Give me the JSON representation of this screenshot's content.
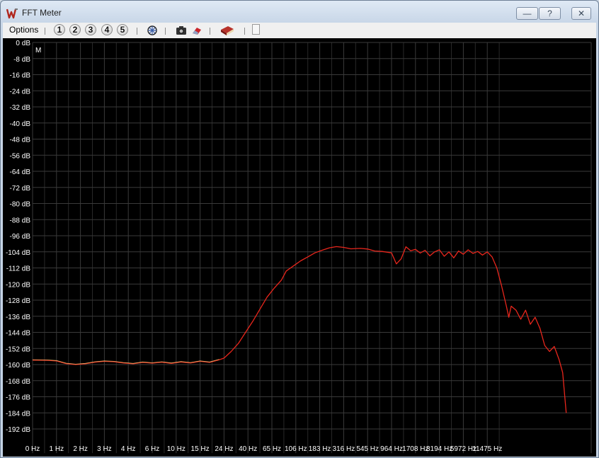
{
  "window": {
    "title": "FFT Meter",
    "minimize_label": "—",
    "help_label": "?",
    "close_label": "✕"
  },
  "toolbar": {
    "options_label": "Options",
    "presets": [
      "1",
      "2",
      "3",
      "4",
      "5"
    ],
    "icons": [
      "grid-icon",
      "camera-icon",
      "eraser-icon",
      "book-icon"
    ]
  },
  "colors": {
    "background": "#000000",
    "grid": "#3a3a3a",
    "axis_text": "#ffffff",
    "trace": "#e8261c",
    "trace_highlight": "#ffd27a"
  },
  "plot": {
    "marker": "M"
  },
  "chart_data": {
    "type": "line",
    "title": "",
    "xlabel": "",
    "ylabel": "",
    "x_scale": "log-like, labeled bins",
    "ylim": [
      -198,
      0
    ],
    "y_ticks": [
      "0 dB",
      "-8 dB",
      "-16 dB",
      "-24 dB",
      "-32 dB",
      "-40 dB",
      "-48 dB",
      "-56 dB",
      "-64 dB",
      "-72 dB",
      "-80 dB",
      "-88 dB",
      "-96 dB",
      "-104 dB",
      "-112 dB",
      "-120 dB",
      "-128 dB",
      "-136 dB",
      "-144 dB",
      "-152 dB",
      "-160 dB",
      "-168 dB",
      "-176 dB",
      "-184 dB",
      "-192 dB"
    ],
    "x_ticks": [
      "0 Hz",
      "1 Hz",
      "2 Hz",
      "3 Hz",
      "4 Hz",
      "6 Hz",
      "10 Hz",
      "15 Hz",
      "24 Hz",
      "40 Hz",
      "65 Hz",
      "106 Hz",
      "183 Hz",
      "316 Hz",
      "545 Hz",
      "964 Hz",
      "1708 Hz",
      "3194 Hz",
      "5972 Hz",
      "11475 Hz"
    ],
    "grid": true,
    "series": [
      {
        "points": [
          [
            0,
            -157.8
          ],
          [
            0.6,
            -157.9
          ],
          [
            1.0,
            -158.2
          ],
          [
            1.4,
            -159.5
          ],
          [
            1.8,
            -160.0
          ],
          [
            2.2,
            -159.6
          ],
          [
            2.6,
            -158.8
          ],
          [
            3.0,
            -158.4
          ],
          [
            3.4,
            -158.6
          ],
          [
            3.8,
            -159.2
          ],
          [
            4.2,
            -159.6
          ],
          [
            4.6,
            -158.9
          ],
          [
            5.0,
            -159.3
          ],
          [
            5.4,
            -158.8
          ],
          [
            5.8,
            -159.4
          ],
          [
            6.2,
            -158.7
          ],
          [
            6.6,
            -159.2
          ],
          [
            7.0,
            -158.4
          ],
          [
            7.4,
            -158.9
          ],
          [
            7.8,
            -157.6
          ],
          [
            8.0,
            -156.8
          ],
          [
            8.3,
            -153.5
          ],
          [
            8.6,
            -149.5
          ],
          [
            8.9,
            -144.0
          ],
          [
            9.2,
            -138.5
          ],
          [
            9.5,
            -132.5
          ],
          [
            9.8,
            -126.5
          ],
          [
            10.1,
            -122.0
          ],
          [
            10.4,
            -118.0
          ],
          [
            10.6,
            -113.5
          ],
          [
            10.9,
            -111.0
          ],
          [
            11.2,
            -108.5
          ],
          [
            11.5,
            -106.5
          ],
          [
            11.8,
            -104.5
          ],
          [
            12.1,
            -103.2
          ],
          [
            12.4,
            -102.0
          ],
          [
            12.7,
            -101.4
          ],
          [
            13.0,
            -101.8
          ],
          [
            13.3,
            -102.5
          ],
          [
            13.7,
            -102.3
          ],
          [
            14.0,
            -102.6
          ],
          [
            14.3,
            -103.6
          ],
          [
            14.6,
            -103.8
          ],
          [
            15.0,
            -104.5
          ],
          [
            15.2,
            -110.0
          ],
          [
            15.4,
            -107.5
          ],
          [
            15.6,
            -101.5
          ],
          [
            15.8,
            -103.5
          ],
          [
            16.0,
            -102.8
          ],
          [
            16.2,
            -104.6
          ],
          [
            16.4,
            -103.2
          ],
          [
            16.6,
            -106.0
          ],
          [
            16.8,
            -104.0
          ],
          [
            17.0,
            -103.0
          ],
          [
            17.2,
            -106.2
          ],
          [
            17.4,
            -104.0
          ],
          [
            17.6,
            -107.0
          ],
          [
            17.8,
            -103.6
          ],
          [
            18.0,
            -105.2
          ],
          [
            18.2,
            -103.0
          ],
          [
            18.4,
            -104.8
          ],
          [
            18.6,
            -103.8
          ],
          [
            18.8,
            -105.6
          ],
          [
            19.0,
            -104.0
          ],
          [
            19.2,
            -106.5
          ],
          [
            19.4,
            -112.0
          ],
          [
            19.6,
            -121.0
          ],
          [
            19.8,
            -131.0
          ],
          [
            19.9,
            -136.5
          ],
          [
            20.0,
            -131.0
          ],
          [
            20.2,
            -133.0
          ],
          [
            20.4,
            -137.5
          ],
          [
            20.6,
            -133.0
          ],
          [
            20.8,
            -140.0
          ],
          [
            21.0,
            -136.5
          ],
          [
            21.2,
            -142.0
          ],
          [
            21.4,
            -150.5
          ],
          [
            21.6,
            -153.5
          ],
          [
            21.8,
            -151.0
          ],
          [
            22.0,
            -157.5
          ],
          [
            22.15,
            -164.0
          ],
          [
            22.3,
            -184.0
          ]
        ]
      }
    ]
  }
}
